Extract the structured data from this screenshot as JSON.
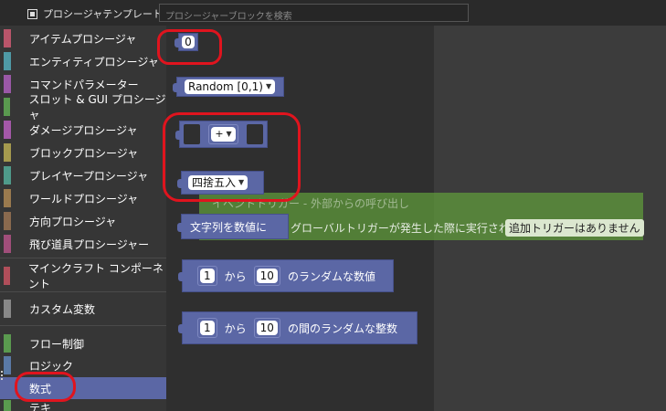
{
  "toolbar": {
    "template_label": "プロシージャテンプレート",
    "search_placeholder": "プロシージャーブロックを検索"
  },
  "sidebar": {
    "items": [
      {
        "label": "アイテムプロシージャ",
        "color": "#b9556a"
      },
      {
        "label": "エンティティプロシージャ",
        "color": "#4f9aa6"
      },
      {
        "label": "コマンドパラメーター",
        "color": "#9a58a6"
      },
      {
        "label": "スロット & GUI プロシージャ",
        "color": "#5a9a4f"
      },
      {
        "label": "ダメージプロシージャ",
        "color": "#a458a8"
      },
      {
        "label": "ブロックプロシージャ",
        "color": "#a59a4e"
      },
      {
        "label": "プレイヤープロシージャ",
        "color": "#4f9a8a"
      },
      {
        "label": "ワールドプロシージャ",
        "color": "#9a7a4e"
      },
      {
        "label": "方向プロシージャ",
        "color": "#8a6a4e"
      },
      {
        "label": "飛び道具プロシージャー",
        "color": "#a04e7a"
      },
      {
        "label": "マインクラフト コンポーネント",
        "color": "#b04e5a"
      },
      {
        "label": "カスタム変数",
        "color": "#888888"
      },
      {
        "label": "フロー制御",
        "color": "#5a9a4f"
      },
      {
        "label": "ロジック",
        "color": "#5a7aa6"
      },
      {
        "label": "数式",
        "color": "#5b67a5"
      },
      {
        "label": "テキ",
        "color": "#5a9a4f"
      }
    ]
  },
  "blocks": {
    "number_value": "0",
    "random_label": "Random [0,1)",
    "operator_value": "+",
    "round_label": "四捨五入",
    "text_to_number": "文字列を数値に",
    "rand_num": {
      "from": "1",
      "kara": "から",
      "to": "10",
      "suffix": "のランダムな数値"
    },
    "rand_int": {
      "from": "1",
      "kara": "から",
      "to": "10",
      "suffix": "の間のランダムな整数"
    }
  },
  "event": {
    "title": "イベントトリガー - 外部からの呼び出し",
    "line": "グローバルトリガーが発生した際に実行される:",
    "pill": "追加トリガーはありません"
  },
  "highlights": [
    "number-block",
    "math-operator-and-round-blocks",
    "category-math"
  ]
}
